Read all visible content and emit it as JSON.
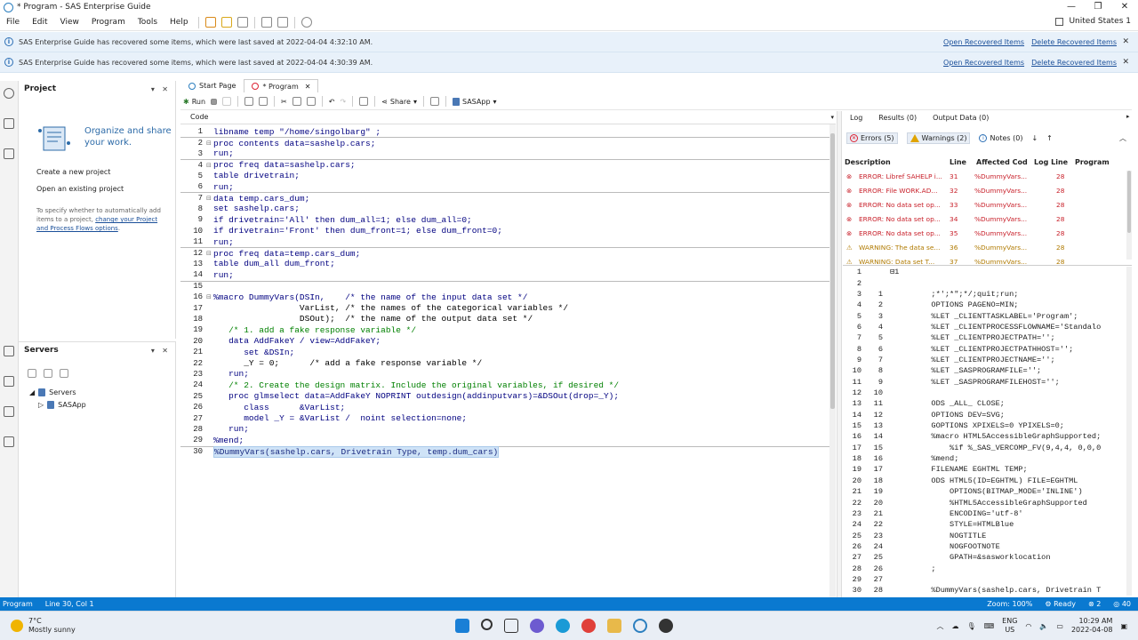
{
  "window": {
    "title": "* Program - SAS Enterprise Guide",
    "region": "United States 1"
  },
  "menu": [
    "File",
    "Edit",
    "View",
    "Program",
    "Tools",
    "Help"
  ],
  "banners": [
    {
      "text": "SAS Enterprise Guide has recovered some items, which were last saved at 2022-04-04 4:32:10 AM.",
      "open": "Open Recovered Items",
      "delete": "Delete Recovered Items"
    },
    {
      "text": "SAS Enterprise Guide has recovered some items, which were last saved at 2022-04-04 4:30:39 AM.",
      "open": "Open Recovered Items",
      "delete": "Delete Recovered Items"
    }
  ],
  "project": {
    "title": "Project",
    "organize": "Organize and share your work.",
    "create": "Create a new project",
    "open": "Open an existing project",
    "hint_prefix": "To specify whether to automatically add items to a project, ",
    "hint_link": "change your Project and Process Flows options",
    "hint_suffix": "."
  },
  "servers": {
    "title": "Servers",
    "root": "Servers",
    "child": "SASApp"
  },
  "tabs": [
    {
      "label": "Start Page"
    },
    {
      "label": "* Program"
    }
  ],
  "toolbar": {
    "run": "Run",
    "share": "Share",
    "server": "SASApp"
  },
  "code_label": "Code",
  "code_lines": [
    {
      "n": "1",
      "fold": "",
      "text": "libname temp \"/home/singolbarg\" ;",
      "sep": false
    },
    {
      "n": "2",
      "fold": "⊟",
      "text": "proc contents data=sashelp.cars;",
      "sep": true
    },
    {
      "n": "3",
      "fold": "",
      "text": "run;",
      "sep": false
    },
    {
      "n": "4",
      "fold": "⊟",
      "text": "proc freq data=sashelp.cars;",
      "sep": true
    },
    {
      "n": "5",
      "fold": "",
      "text": "table drivetrain;",
      "sep": false
    },
    {
      "n": "6",
      "fold": "",
      "text": "run;",
      "sep": false
    },
    {
      "n": "7",
      "fold": "⊟",
      "text": "data temp.cars_dum;",
      "sep": true
    },
    {
      "n": "8",
      "fold": "",
      "text": "set sashelp.cars;",
      "sep": false
    },
    {
      "n": "9",
      "fold": "",
      "text": "if drivetrain='All' then dum_all=1; else dum_all=0;",
      "sep": false
    },
    {
      "n": "10",
      "fold": "",
      "text": "if drivetrain='Front' then dum_front=1; else dum_front=0;",
      "sep": false
    },
    {
      "n": "11",
      "fold": "",
      "text": "run;",
      "sep": false
    },
    {
      "n": "12",
      "fold": "⊟",
      "text": "proc freq data=temp.cars_dum;",
      "sep": true
    },
    {
      "n": "13",
      "fold": "",
      "text": "table dum_all dum_front;",
      "sep": false
    },
    {
      "n": "14",
      "fold": "",
      "text": "run;",
      "sep": false
    },
    {
      "n": "15",
      "fold": "",
      "text": "",
      "sep": true
    },
    {
      "n": "16",
      "fold": "⊟",
      "text": "%macro DummyVars(DSIn,    /* the name of the input data set */",
      "sep": false
    },
    {
      "n": "17",
      "fold": "",
      "text": "                 VarList, /* the names of the categorical variables */",
      "sep": false
    },
    {
      "n": "18",
      "fold": "",
      "text": "                 DSOut);  /* the name of the output data set */",
      "sep": false
    },
    {
      "n": "19",
      "fold": "",
      "text": "   /* 1. add a fake response variable */",
      "sep": false
    },
    {
      "n": "20",
      "fold": "",
      "text": "   data AddFakeY / view=AddFakeY;",
      "sep": false
    },
    {
      "n": "21",
      "fold": "",
      "text": "      set &DSIn;",
      "sep": false
    },
    {
      "n": "22",
      "fold": "",
      "text": "      _Y = 0;      /* add a fake response variable */",
      "sep": false
    },
    {
      "n": "23",
      "fold": "",
      "text": "   run;",
      "sep": false
    },
    {
      "n": "24",
      "fold": "",
      "text": "   /* 2. Create the design matrix. Include the original variables, if desired */",
      "sep": false
    },
    {
      "n": "25",
      "fold": "",
      "text": "   proc glmselect data=AddFakeY NOPRINT outdesign(addinputvars)=&DSOut(drop=_Y);",
      "sep": false
    },
    {
      "n": "26",
      "fold": "",
      "text": "      class      &VarList;",
      "sep": false
    },
    {
      "n": "27",
      "fold": "",
      "text": "      model _Y = &VarList /  noint selection=none;",
      "sep": false
    },
    {
      "n": "28",
      "fold": "",
      "text": "   run;",
      "sep": false
    },
    {
      "n": "29",
      "fold": "",
      "text": "%mend;",
      "sep": false
    },
    {
      "n": "30",
      "fold": "",
      "text": "%DummyVars(sashelp.cars, Drivetrain Type, temp.dum_cars)",
      "sep": true,
      "selected": true
    }
  ],
  "log_tabs": [
    "Log",
    "Results (0)",
    "Output Data (0)"
  ],
  "filters": {
    "errors": "Errors (5)",
    "warnings": "Warnings (2)",
    "notes": "Notes (0)"
  },
  "msg_headers": [
    "Description",
    "Line",
    "Affected Cod",
    "Log Line",
    "Program"
  ],
  "messages": [
    {
      "kind": "error",
      "desc": "ERROR: Libref SAHELP i...",
      "line": "31",
      "code": "%DummyVars...",
      "logline": "28"
    },
    {
      "kind": "error",
      "desc": "ERROR: File WORK.AD...",
      "line": "32",
      "code": "%DummyVars...",
      "logline": "28"
    },
    {
      "kind": "error",
      "desc": "ERROR: No data set op...",
      "line": "33",
      "code": "%DummyVars...",
      "logline": "28"
    },
    {
      "kind": "error",
      "desc": "ERROR: No data set op...",
      "line": "34",
      "code": "%DummyVars...",
      "logline": "28"
    },
    {
      "kind": "error",
      "desc": "ERROR: No data set op...",
      "line": "35",
      "code": "%DummyVars...",
      "logline": "28"
    },
    {
      "kind": "warn",
      "desc": "WARNING: The data se...",
      "line": "36",
      "code": "%DummyVars...",
      "logline": "28"
    },
    {
      "kind": "warn",
      "desc": "WARNING: Data set T...",
      "line": "37",
      "code": "%DummyVars...",
      "logline": "28"
    }
  ],
  "log_lines": [
    {
      "a": "1",
      "b": "",
      "t": "⊟1"
    },
    {
      "a": "2",
      "b": "",
      "t": ""
    },
    {
      "a": "3",
      "b": "1",
      "t": "         ;*';*\";*/;quit;run;"
    },
    {
      "a": "4",
      "b": "2",
      "t": "         OPTIONS PAGENO=MIN;"
    },
    {
      "a": "5",
      "b": "3",
      "t": "         %LET _CLIENTTASKLABEL='Program';"
    },
    {
      "a": "6",
      "b": "4",
      "t": "         %LET _CLIENTPROCESSFLOWNAME='Standalo"
    },
    {
      "a": "7",
      "b": "5",
      "t": "         %LET _CLIENTPROJECTPATH='';"
    },
    {
      "a": "8",
      "b": "6",
      "t": "         %LET _CLIENTPROJECTPATHHOST='';"
    },
    {
      "a": "9",
      "b": "7",
      "t": "         %LET _CLIENTPROJECTNAME='';"
    },
    {
      "a": "10",
      "b": "8",
      "t": "         %LET _SASPROGRAMFILE='';"
    },
    {
      "a": "11",
      "b": "9",
      "t": "         %LET _SASPROGRAMFILEHOST='';"
    },
    {
      "a": "12",
      "b": "10",
      "t": ""
    },
    {
      "a": "13",
      "b": "11",
      "t": "         ODS _ALL_ CLOSE;"
    },
    {
      "a": "14",
      "b": "12",
      "t": "         OPTIONS DEV=SVG;"
    },
    {
      "a": "15",
      "b": "13",
      "t": "         GOPTIONS XPIXELS=0 YPIXELS=0;"
    },
    {
      "a": "16",
      "b": "14",
      "t": "         %macro HTML5AccessibleGraphSupported;"
    },
    {
      "a": "17",
      "b": "15",
      "t": "             %if %_SAS_VERCOMP_FV(9,4,4, 0,0,0"
    },
    {
      "a": "18",
      "b": "16",
      "t": "         %mend;"
    },
    {
      "a": "19",
      "b": "17",
      "t": "         FILENAME EGHTML TEMP;"
    },
    {
      "a": "20",
      "b": "18",
      "t": "         ODS HTML5(ID=EGHTML) FILE=EGHTML"
    },
    {
      "a": "21",
      "b": "19",
      "t": "             OPTIONS(BITMAP_MODE='INLINE')"
    },
    {
      "a": "22",
      "b": "20",
      "t": "             %HTML5AccessibleGraphSupported"
    },
    {
      "a": "23",
      "b": "21",
      "t": "             ENCODING='utf-8'"
    },
    {
      "a": "24",
      "b": "22",
      "t": "             STYLE=HTMLBlue"
    },
    {
      "a": "25",
      "b": "23",
      "t": "             NOGTITLE"
    },
    {
      "a": "26",
      "b": "24",
      "t": "             NOGFOOTNOTE"
    },
    {
      "a": "27",
      "b": "25",
      "t": "             GPATH=&sasworklocation"
    },
    {
      "a": "28",
      "b": "26",
      "t": "         ;"
    },
    {
      "a": "29",
      "b": "27",
      "t": ""
    },
    {
      "a": "30",
      "b": "28",
      "t": "         %DummyVars(sashelp.cars, Drivetrain T"
    }
  ],
  "status": {
    "program": "Program",
    "pos": "Line 30, Col 1",
    "zoom": "Zoom: 100%",
    "ready": "Ready",
    "errors": "2",
    "count": "40"
  },
  "taskbar": {
    "temp": "7°C",
    "weather": "Mostly sunny",
    "lang1": "ENG",
    "lang2": "US",
    "time": "10:29 AM",
    "date": "2022-04-08"
  },
  "colors": {
    "accent": "#0a79d0",
    "error": "#c8202a",
    "warning": "#e0a400",
    "link": "#1a4f99",
    "keyword": "#000080",
    "comment": "#008000",
    "string": "#800080"
  }
}
